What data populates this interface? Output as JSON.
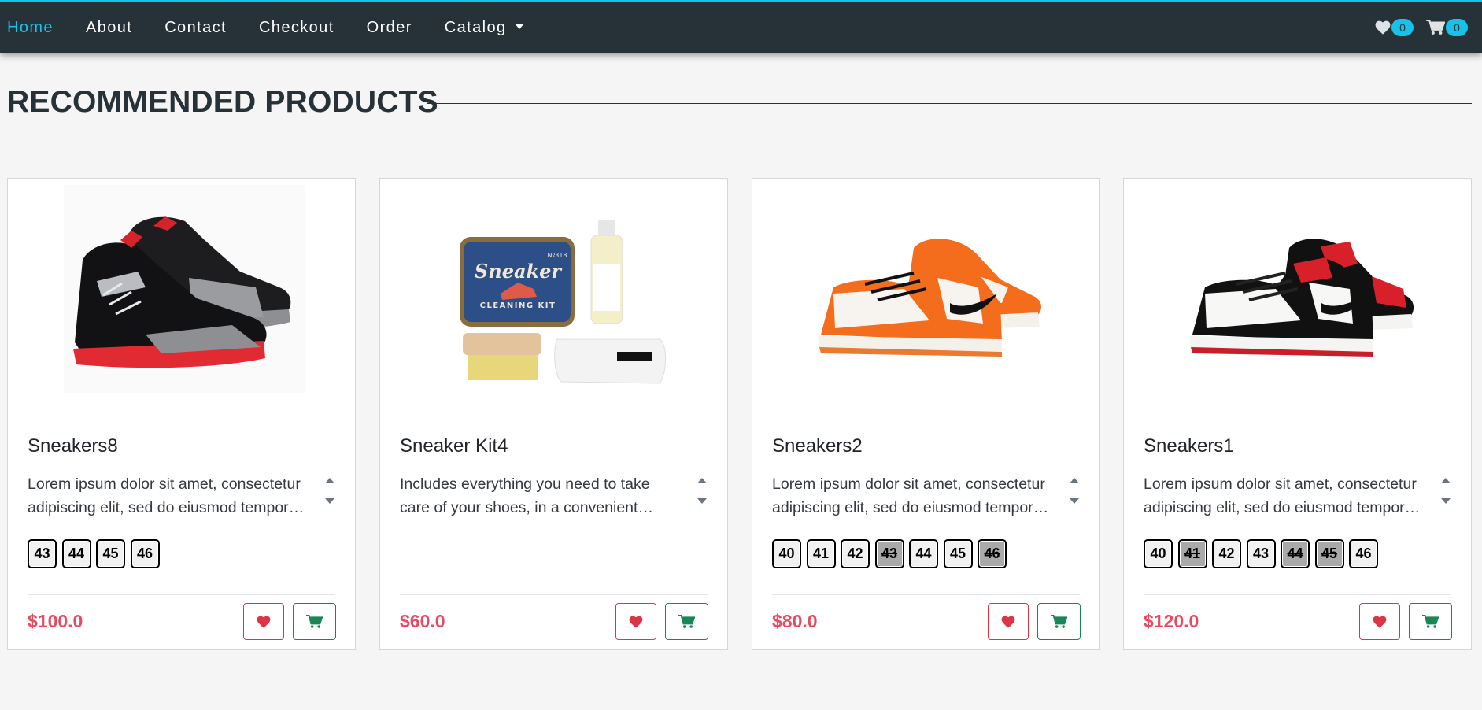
{
  "nav": {
    "links": [
      "Home",
      "About",
      "Contact",
      "Checkout",
      "Order",
      "Catalog"
    ],
    "active": "Home",
    "catalog_icon": "caret-down-icon",
    "wishlist": {
      "icon": "heart-icon",
      "count": "0"
    },
    "cart": {
      "icon": "cart-icon",
      "count": "0"
    }
  },
  "section": {
    "title": "RECOMMENDED PRODUCTS"
  },
  "products": [
    {
      "title": "Sneakers8",
      "description": "Lorem ipsum dolor sit amet, consectetur adipiscing elit, sed do eiusmod tempor incididunt ut labore et dolore magna aliqua.",
      "sizes": [
        "43",
        "44",
        "45",
        "46"
      ],
      "unavailable_sizes": [],
      "price": "$100.0",
      "image": "black-red-sneakers-image"
    },
    {
      "title": "Sneaker Kit4",
      "description": "Includes everything you need to take care of your shoes, in a convenient compact case.",
      "sizes": [],
      "unavailable_sizes": [],
      "price": "$60.0",
      "image": "sneaker-cleaning-kit-image",
      "kit_box_text": "Sneaker",
      "kit_box_subtext": "CLEANING KIT",
      "kit_box_number": "Nº318"
    },
    {
      "title": "Sneakers2",
      "description": "Lorem ipsum dolor sit amet, consectetur adipiscing elit, sed do eiusmod tempor incididunt ut labore et dolore magna aliqua.",
      "sizes": [
        "40",
        "41",
        "42",
        "43",
        "44",
        "45",
        "46"
      ],
      "unavailable_sizes": [
        "43",
        "46"
      ],
      "price": "$80.0",
      "image": "orange-white-sneakers-image"
    },
    {
      "title": "Sneakers1",
      "description": "Lorem ipsum dolor sit amet, consectetur adipiscing elit, sed do eiusmod tempor incididunt ut labore et dolore magna aliqua.",
      "sizes": [
        "40",
        "41",
        "42",
        "43",
        "44",
        "45",
        "46"
      ],
      "unavailable_sizes": [
        "41",
        "44",
        "45"
      ],
      "price": "$120.0",
      "image": "red-black-white-sneakers-image"
    }
  ],
  "actions": {
    "wishlist_icon": "heart-icon",
    "cart_icon": "cart-icon"
  },
  "colors": {
    "nav_bg": "#263238",
    "accent": "#17c1e8",
    "price": "#e84a5f",
    "wish": "#dc3545",
    "cart": "#198754"
  }
}
